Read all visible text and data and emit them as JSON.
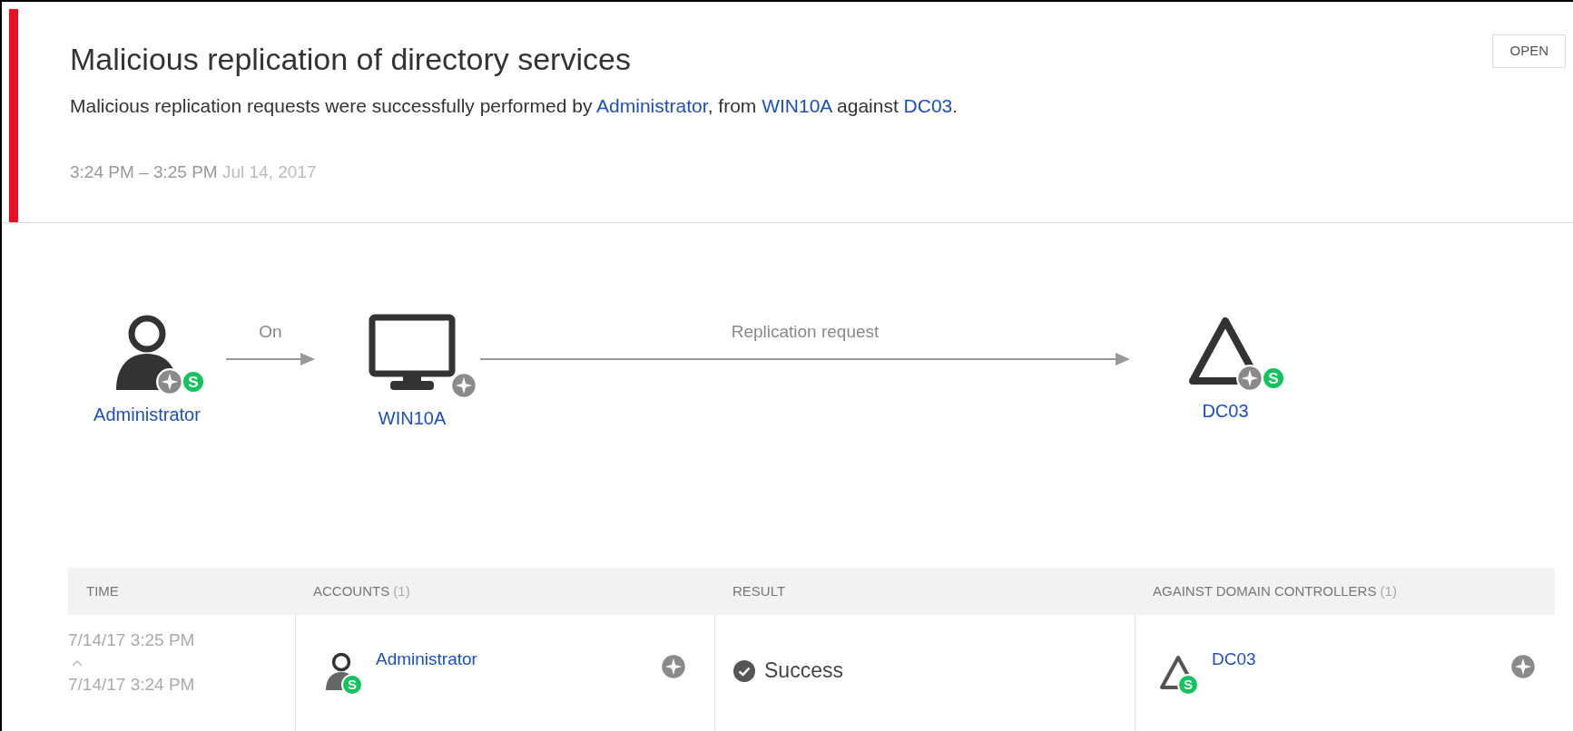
{
  "alert": {
    "title": "Malicious replication of directory services",
    "status_button": "OPEN",
    "description": [
      {
        "kind": "text",
        "text": "Malicious replication requests were successfully performed by "
      },
      {
        "kind": "link",
        "text": "Administrator"
      },
      {
        "kind": "text",
        "text": ", from "
      },
      {
        "kind": "link",
        "text": "WIN10A"
      },
      {
        "kind": "text",
        "text": " against "
      },
      {
        "kind": "link",
        "text": "DC03"
      },
      {
        "kind": "text",
        "text": "."
      }
    ],
    "time_range": "3:24 PM – 3:25 PM",
    "date": "Jul 14, 2017"
  },
  "diagram": {
    "source": {
      "kind": "user",
      "name": "Administrator",
      "badge": "S"
    },
    "first_edge": "On",
    "machine": {
      "kind": "computer",
      "name": "WIN10A"
    },
    "second_edge": "Replication request",
    "target": {
      "kind": "domain-controller",
      "name": "DC03",
      "badge": "S"
    }
  },
  "table": {
    "columns": [
      {
        "label": "TIME"
      },
      {
        "label": "ACCOUNTS",
        "count": "(1)"
      },
      {
        "label": "RESULT"
      },
      {
        "label": "AGAINST DOMAIN CONTROLLERS",
        "count": "(1)"
      }
    ],
    "rows": [
      {
        "time_end": "7/14/17 3:25 PM",
        "time_start": "7/14/17 3:24 PM",
        "account": {
          "kind": "user",
          "name": "Administrator",
          "badge": "S"
        },
        "result": "Success",
        "controller": {
          "kind": "domain-controller",
          "name": "DC03",
          "badge": "S"
        }
      }
    ]
  }
}
